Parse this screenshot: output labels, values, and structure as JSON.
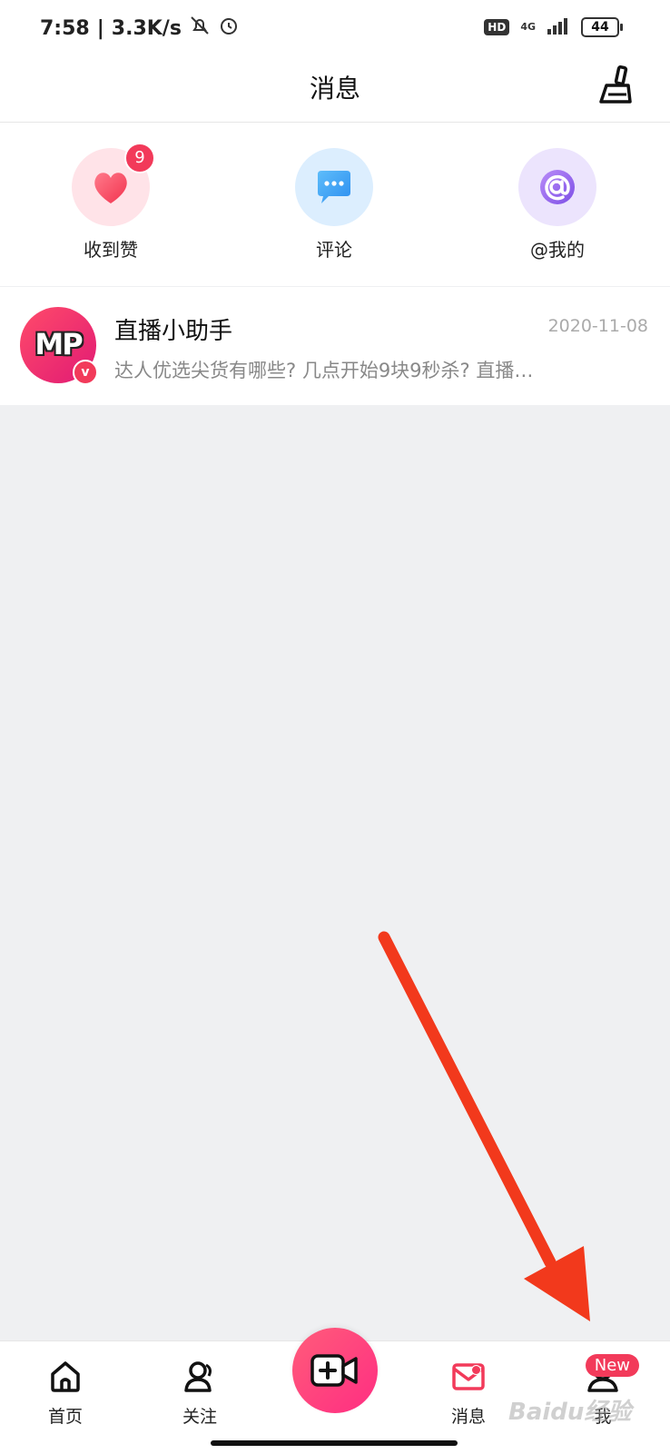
{
  "status": {
    "time": "7:58",
    "speed": "3.3K/s",
    "hd": "HD",
    "network": "4G",
    "battery": "44"
  },
  "header": {
    "title": "消息"
  },
  "quick": [
    {
      "label": "收到赞",
      "badge": "9",
      "icon": "heart-icon",
      "color": "#ff4d6d"
    },
    {
      "label": "评论",
      "icon": "comment-icon",
      "color": "#3fa3f5"
    },
    {
      "label": "@我的",
      "icon": "at-icon",
      "color": "#9b6cf0"
    }
  ],
  "messages": [
    {
      "name": "直播小助手",
      "date": "2020-11-08",
      "preview": "达人优选尖货有哪些? 几点开始9块9秒杀? 直播…",
      "avatar_text": "MP",
      "verified": "v"
    }
  ],
  "tabbar": {
    "home": "首页",
    "follow": "关注",
    "messages": "消息",
    "me": "我",
    "me_badge": "New"
  },
  "watermark": "Baidu经验",
  "colors": {
    "accent": "#f23a5a",
    "arrow": "#f2391c"
  }
}
